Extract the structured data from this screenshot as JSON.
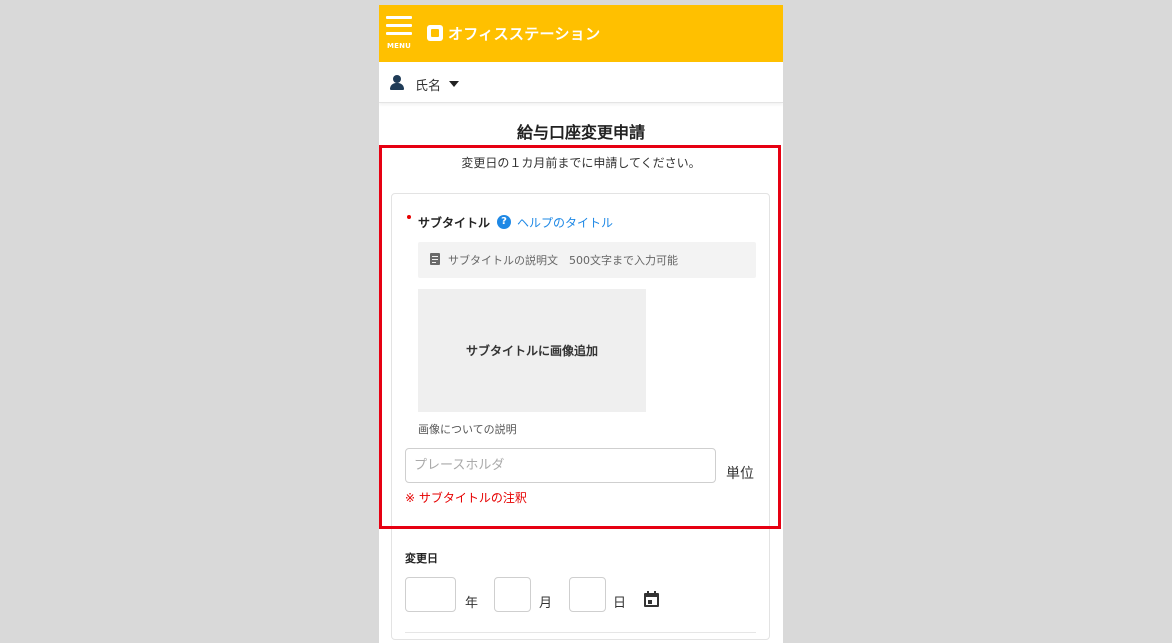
{
  "header": {
    "menu_label": "MENU",
    "logo_text": "オフィスステーション",
    "brand_color": "#ffc000"
  },
  "user": {
    "name": "氏名"
  },
  "page": {
    "title": "給与口座変更申請",
    "notice": "変更日の１カ月前までに申請してください。"
  },
  "subtitle_field": {
    "label": "サブタイトル",
    "help_link": "ヘルプのタイトル",
    "description": "サブタイトルの説明文　500文字まで入力可能",
    "image_placeholder": "サブタイトルに画像追加",
    "image_caption": "画像についての説明",
    "input_value": "",
    "input_placeholder": "プレースホルダ",
    "unit": "単位",
    "annotation": "※ サブタイトルの注釈"
  },
  "date_field": {
    "label": "変更日",
    "year_unit": "年",
    "month_unit": "月",
    "day_unit": "日",
    "year_value": "",
    "month_value": "",
    "day_value": ""
  },
  "highlight_color": "#e60012"
}
